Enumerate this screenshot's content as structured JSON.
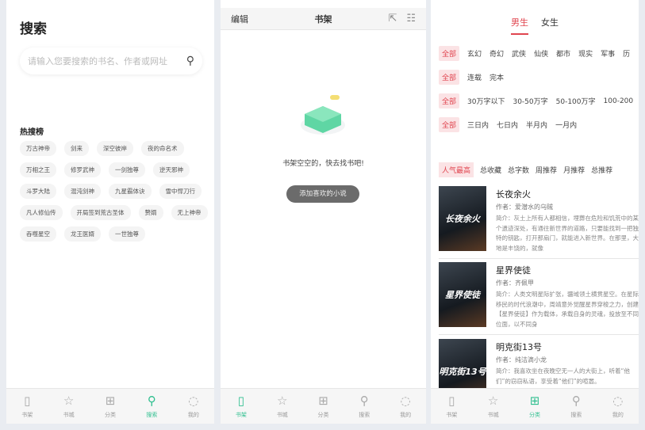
{
  "nav": [
    {
      "label": "书架",
      "icon": "bookshelf-icon",
      "glyph": "▯"
    },
    {
      "label": "书城",
      "icon": "star-icon",
      "glyph": "☆"
    },
    {
      "label": "分类",
      "icon": "grid-icon",
      "glyph": "⊞"
    },
    {
      "label": "搜索",
      "icon": "search-icon",
      "glyph": "⚲"
    },
    {
      "label": "我的",
      "icon": "profile-icon",
      "glyph": "◌"
    }
  ],
  "search": {
    "title": "搜索",
    "placeholder": "请输入您要搜索的书名、作者或网址",
    "hot_title": "热搜榜",
    "hot": [
      "万古神帝",
      "剑来",
      "深空彼岸",
      "夜的命名术",
      "万相之王",
      "修罗武神",
      "一剑独尊",
      "逆天邪神",
      "斗罗大陆",
      "混沌剑神",
      "九星霸体诀",
      "雪中悍刀行",
      "凡人修仙传",
      "开局签到荒古圣体",
      "赘婿",
      "无上神帝",
      "吞噬星空",
      "龙王医婿",
      "一世独尊"
    ]
  },
  "shelf": {
    "edit": "编辑",
    "title": "书架",
    "empty": "书架空空的，快去找书吧!",
    "add": "添加喜欢的小说"
  },
  "category": {
    "sex": [
      "男生",
      "女生"
    ],
    "rows": [
      [
        "全部",
        "玄幻",
        "奇幻",
        "武侠",
        "仙侠",
        "都市",
        "现实",
        "军事",
        "历"
      ],
      [
        "全部",
        "连载",
        "完本"
      ],
      [
        "全部",
        "30万字以下",
        "30-50万字",
        "50-100万字",
        "100-200"
      ],
      [
        "全部",
        "三日内",
        "七日内",
        "半月内",
        "一月内"
      ]
    ],
    "sort": [
      "人气最高",
      "总收藏",
      "总字数",
      "周推荐",
      "月推荐",
      "总推荐"
    ],
    "books": [
      {
        "title": "长夜余火",
        "author": "作者：爱潜水的乌贼",
        "desc": "简介：灰土上所有人都相信，埋葬在危险和饥荒中的某个遗迹深处，有通往新世界的道路，只要能找到一把独特的钥匙，打开那扇门，就能进入新世界。在那里，大地是丰饶的，就像",
        "cover": "长夜余火"
      },
      {
        "title": "星界使徒",
        "author": "作者：齐佩甲",
        "desc": "简介：人类文明星际扩张，疆域领土横贯星空。在星际移民的时代浪潮中，周靖意外觉醒星界穿梭之力，创建【星界使徒】作为载体，承载自身的灵魂，投放至不同位面，以不同身",
        "cover": "星界使徒"
      },
      {
        "title": "明克街13号",
        "author": "作者：纯洁滴小龙",
        "desc": "简介：我喜欢坐在夜晚空无一人的大街上，听着“他们”的窃窃私语，享受着“他们”的喧嚣。",
        "cover": "明克街13号"
      }
    ]
  }
}
